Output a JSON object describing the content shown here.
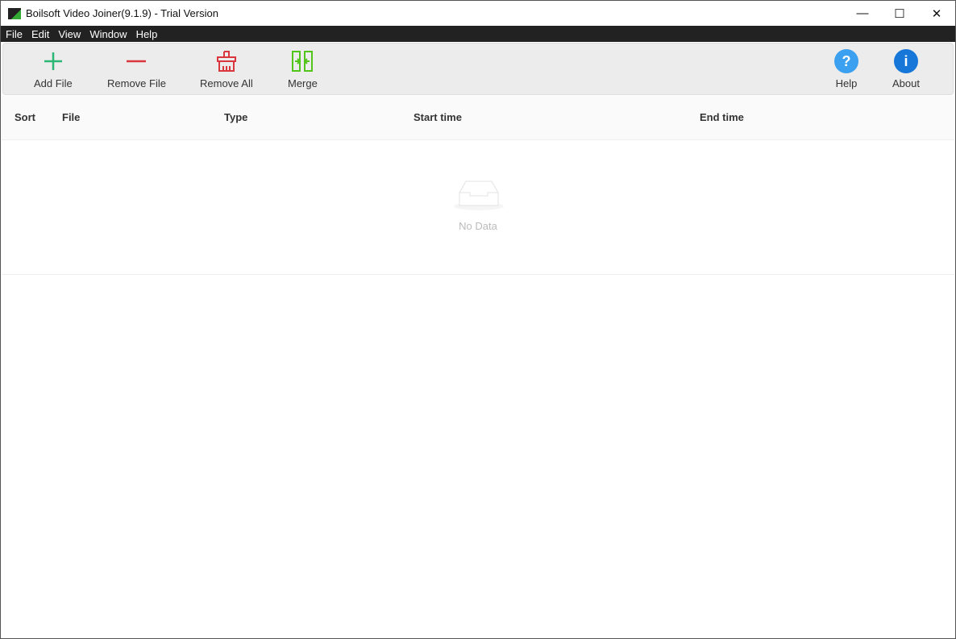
{
  "window": {
    "title": "Boilsoft Video Joiner(9.1.9) - Trial Version"
  },
  "menu": [
    "File",
    "Edit",
    "View",
    "Window",
    "Help"
  ],
  "toolbar": {
    "add_file": "Add File",
    "remove_file": "Remove File",
    "remove_all": "Remove All",
    "merge": "Merge",
    "help": "Help",
    "about": "About"
  },
  "table": {
    "columns": [
      "Sort",
      "File",
      "Type",
      "Start time",
      "End time"
    ],
    "empty_text": "No Data"
  },
  "colors": {
    "add": "#2bb673",
    "remove": "#d9363e",
    "merge": "#52c41a",
    "help": "#3ba0f0",
    "about": "#1677d9"
  }
}
